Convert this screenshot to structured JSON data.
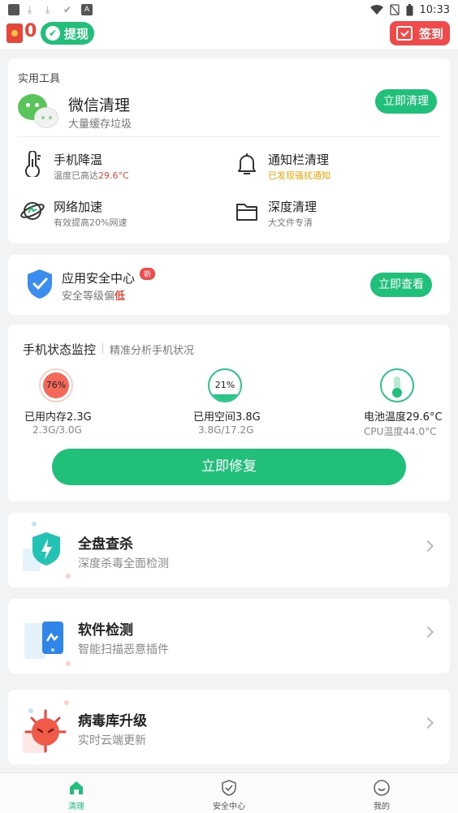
{
  "status_bar": {
    "time": "10:33",
    "notif_letter": "A"
  },
  "top_bar": {
    "coin_count": "0",
    "withdraw_label": "提现",
    "signin_label": "签到"
  },
  "tools": {
    "section_title": "实用工具",
    "wechat": {
      "title": "微信清理",
      "subtitle": "大量缓存垃圾",
      "button": "立即清理"
    },
    "items": [
      {
        "name": "手机降温",
        "desc_prefix": "温度已高达",
        "desc_value": "29.6°C",
        "icon": "thermometer-icon"
      },
      {
        "name": "通知栏清理",
        "desc_warn": "已发现骚扰通知",
        "icon": "bell-icon"
      },
      {
        "name": "网络加速",
        "desc": "有效提高20%网速",
        "icon": "network-icon"
      },
      {
        "name": "深度清理",
        "desc": "大文件专清",
        "icon": "folder-icon"
      }
    ]
  },
  "security": {
    "title": "应用安全中心",
    "badge": "新",
    "subtitle_prefix": "安全等级偏",
    "subtitle_level": "低",
    "button": "立即查看"
  },
  "monitor": {
    "title": "手机状态监控",
    "subtitle": "精准分析手机状况",
    "memory": {
      "percent_label": "76%",
      "percent": 76,
      "label": "已用内存2.3G",
      "detail": "2.3G/3.0G"
    },
    "space": {
      "percent_label": "21%",
      "percent": 21,
      "label": "已用空间3.8G",
      "detail": "3.8G/17.2G"
    },
    "battery": {
      "label": "电池温度29.6°C",
      "detail": "CPU温度44.0°C"
    },
    "fix_button": "立即修复"
  },
  "features": [
    {
      "title": "全盘查杀",
      "subtitle": "深度杀毒全面检测",
      "icon": "lightning-shield-icon"
    },
    {
      "title": "软件检测",
      "subtitle": "智能扫描恶意插件",
      "icon": "phone-scan-icon"
    },
    {
      "title": "病毒库升级",
      "subtitle": "实时云端更新",
      "icon": "virus-icon"
    }
  ],
  "tabs": [
    {
      "label": "清理",
      "icon": "home-icon",
      "active": true
    },
    {
      "label": "安全中心",
      "icon": "shield-check-icon",
      "active": false
    },
    {
      "label": "我的",
      "icon": "smile-icon",
      "active": false
    }
  ],
  "colors": {
    "primary_green": "#21c07a",
    "alert_red": "#f04a4a",
    "warn_orange": "#f0a500"
  }
}
